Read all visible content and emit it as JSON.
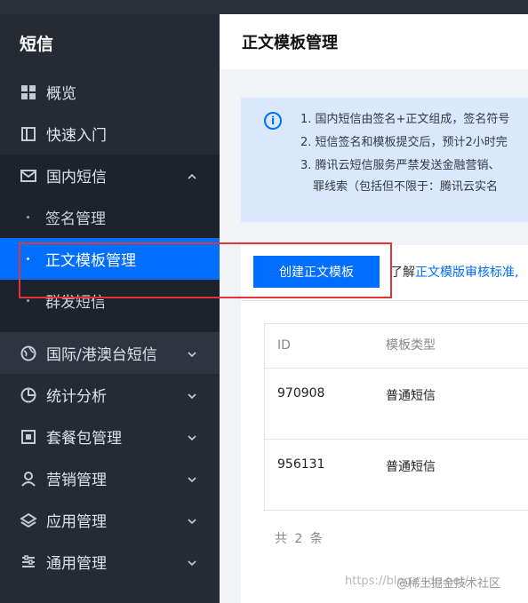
{
  "sidebar": {
    "brand": "短信",
    "items": [
      {
        "label": "概览",
        "icon": "grid-icon"
      },
      {
        "label": "快速入门",
        "icon": "book-icon"
      }
    ],
    "group": {
      "label": "国内短信",
      "icon": "mail-icon",
      "expanded": true,
      "children": [
        {
          "label": "签名管理"
        },
        {
          "label": "正文模板管理",
          "active": true
        },
        {
          "label": "群发短信"
        }
      ]
    },
    "more": [
      {
        "label": "国际/港澳台短信",
        "icon": "globe-icon"
      },
      {
        "label": "统计分析",
        "icon": "pie-icon"
      },
      {
        "label": "套餐包管理",
        "icon": "package-icon"
      },
      {
        "label": "营销管理",
        "icon": "user-icon"
      },
      {
        "label": "应用管理",
        "icon": "layers-icon"
      },
      {
        "label": "通用管理",
        "icon": "sliders-icon"
      }
    ]
  },
  "header": {
    "title": "正文模板管理"
  },
  "notice": {
    "lines": [
      "1. 国内短信由签名+正文组成，签名符号",
      "2. 短信签名和模板提交后，预计2小时完",
      "3. 腾讯云短信服务严禁发送金融营销、",
      "罪线索（包括但不限于：腾讯云实名"
    ]
  },
  "toolbar": {
    "create_label": "创建正文模板",
    "hint_prefix": "了解",
    "hint_link": "正文模版审核标准,"
  },
  "table": {
    "columns": [
      "ID",
      "模板类型"
    ],
    "rows": [
      {
        "id": "970908",
        "type": "普通短信"
      },
      {
        "id": "956131",
        "type": "普通短信"
      }
    ],
    "total": "共 2 条"
  },
  "watermark": {
    "url": "https://blog.csdn.net/",
    "brand": "@稀土掘金技术社区"
  },
  "colors": {
    "accent": "#006eff",
    "sidebar_bg": "#252b34",
    "highlight_box": "#e0353a",
    "notice_bg": "#d9e8fd"
  }
}
